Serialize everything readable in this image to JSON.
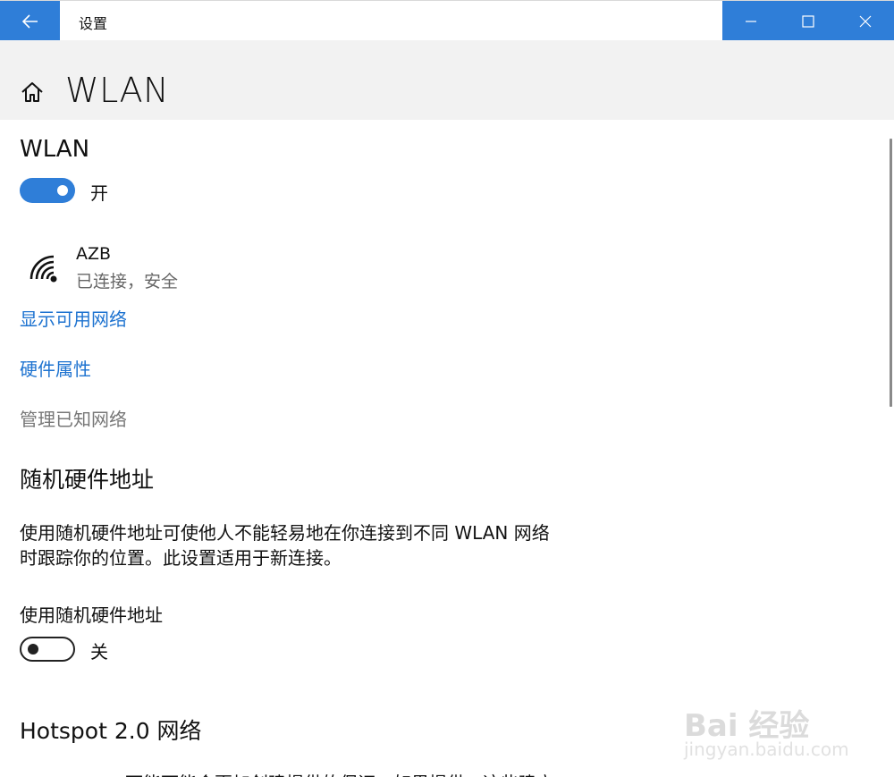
{
  "titlebar": {
    "app_title": "设置"
  },
  "header": {
    "title": "WLAN"
  },
  "wlan": {
    "section_title": "WLAN",
    "toggle_state": "on",
    "toggle_label": "开"
  },
  "network": {
    "name": "AZB",
    "status": "已连接，安全"
  },
  "links": {
    "show_available": "显示可用网络",
    "hardware_properties": "硬件属性",
    "manage_known": "管理已知网络"
  },
  "random_mac": {
    "title": "随机硬件地址",
    "description_line1": "使用随机硬件地址可使他人不能轻易地在你连接到不同 WLAN 网络",
    "description_line2": "时跟踪你的位置。此设置适用于新连接。",
    "setting_label": "使用随机硬件地址",
    "toggle_state": "off",
    "toggle_label": "关"
  },
  "hotspot": {
    "title": "Hotspot 2.0 网络",
    "cut_off_text": "可能可能会更加创建提供的保证，如果提供，这些建立"
  },
  "watermark": {
    "logo": "Bai 经验",
    "url": "jingyan.baidu.com"
  },
  "colors": {
    "accent": "#2f7ed8",
    "link": "#1e73d0",
    "header_bg": "#f2f2f2"
  }
}
